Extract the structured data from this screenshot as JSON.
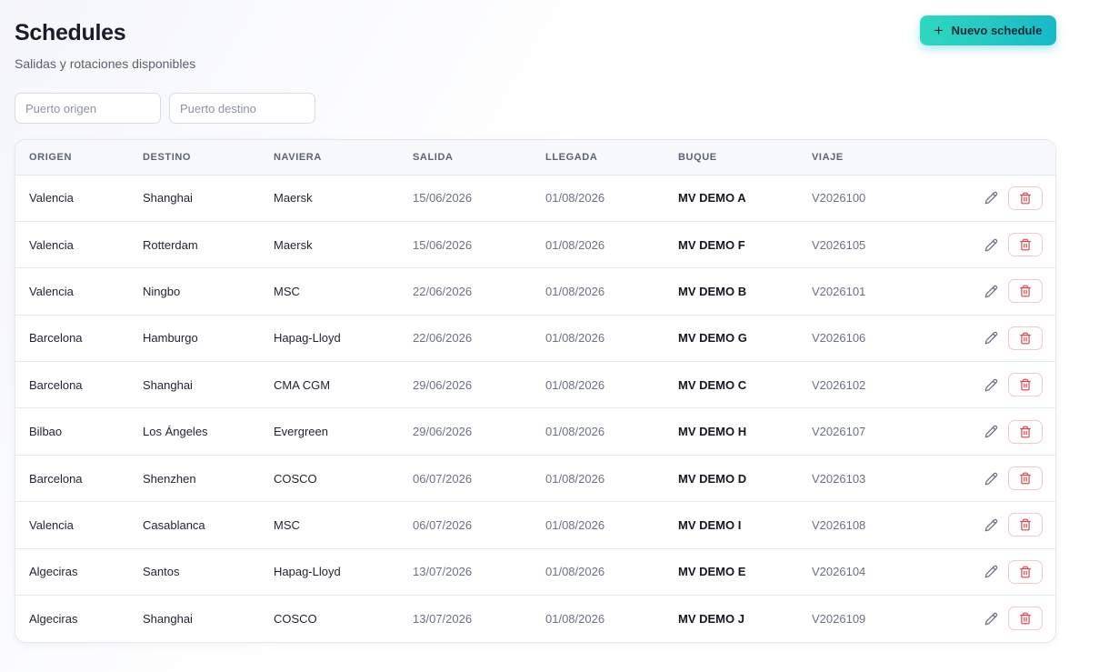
{
  "page": {
    "title": "Schedules",
    "subtitle": "Salidas y rotaciones disponibles",
    "new_button_label": "Nuevo schedule",
    "new_button_icon": "plus-icon"
  },
  "filters": {
    "origin_placeholder": "Puerto origen",
    "destination_placeholder": "Puerto destino"
  },
  "table": {
    "columns": [
      "ORIGEN",
      "DESTINO",
      "NAVIERA",
      "SALIDA",
      "LLEGADA",
      "BUQUE",
      "VIAJE"
    ],
    "rows": [
      {
        "origen": "Valencia",
        "destino": "Shanghai",
        "naviera": "Maersk",
        "salida": "15/06/2026",
        "llegada": "01/08/2026",
        "buque": "MV DEMO A",
        "viaje": "V2026100"
      },
      {
        "origen": "Valencia",
        "destino": "Rotterdam",
        "naviera": "Maersk",
        "salida": "15/06/2026",
        "llegada": "01/08/2026",
        "buque": "MV DEMO F",
        "viaje": "V2026105"
      },
      {
        "origen": "Valencia",
        "destino": "Ningbo",
        "naviera": "MSC",
        "salida": "22/06/2026",
        "llegada": "01/08/2026",
        "buque": "MV DEMO B",
        "viaje": "V2026101"
      },
      {
        "origen": "Barcelona",
        "destino": "Hamburgo",
        "naviera": "Hapag-Lloyd",
        "salida": "22/06/2026",
        "llegada": "01/08/2026",
        "buque": "MV DEMO G",
        "viaje": "V2026106"
      },
      {
        "origen": "Barcelona",
        "destino": "Shanghai",
        "naviera": "CMA CGM",
        "salida": "29/06/2026",
        "llegada": "01/08/2026",
        "buque": "MV DEMO C",
        "viaje": "V2026102"
      },
      {
        "origen": "Bilbao",
        "destino": "Los Ángeles",
        "naviera": "Evergreen",
        "salida": "29/06/2026",
        "llegada": "01/08/2026",
        "buque": "MV DEMO H",
        "viaje": "V2026107"
      },
      {
        "origen": "Barcelona",
        "destino": "Shenzhen",
        "naviera": "COSCO",
        "salida": "06/07/2026",
        "llegada": "01/08/2026",
        "buque": "MV DEMO D",
        "viaje": "V2026103"
      },
      {
        "origen": "Valencia",
        "destino": "Casablanca",
        "naviera": "MSC",
        "salida": "06/07/2026",
        "llegada": "01/08/2026",
        "buque": "MV DEMO I",
        "viaje": "V2026108"
      },
      {
        "origen": "Algeciras",
        "destino": "Santos",
        "naviera": "Hapag-Lloyd",
        "salida": "13/07/2026",
        "llegada": "01/08/2026",
        "buque": "MV DEMO E",
        "viaje": "V2026104"
      },
      {
        "origen": "Algeciras",
        "destino": "Shanghai",
        "naviera": "COSCO",
        "salida": "13/07/2026",
        "llegada": "01/08/2026",
        "buque": "MV DEMO J",
        "viaje": "V2026109"
      }
    ],
    "row_actions": {
      "edit_icon": "pencil-icon",
      "delete_icon": "trash-icon"
    }
  },
  "colors": {
    "accent_start": "#2fd8c0",
    "accent_end": "#18b9c8",
    "delete": "#e0414b",
    "muted_text": "#6b7282"
  }
}
